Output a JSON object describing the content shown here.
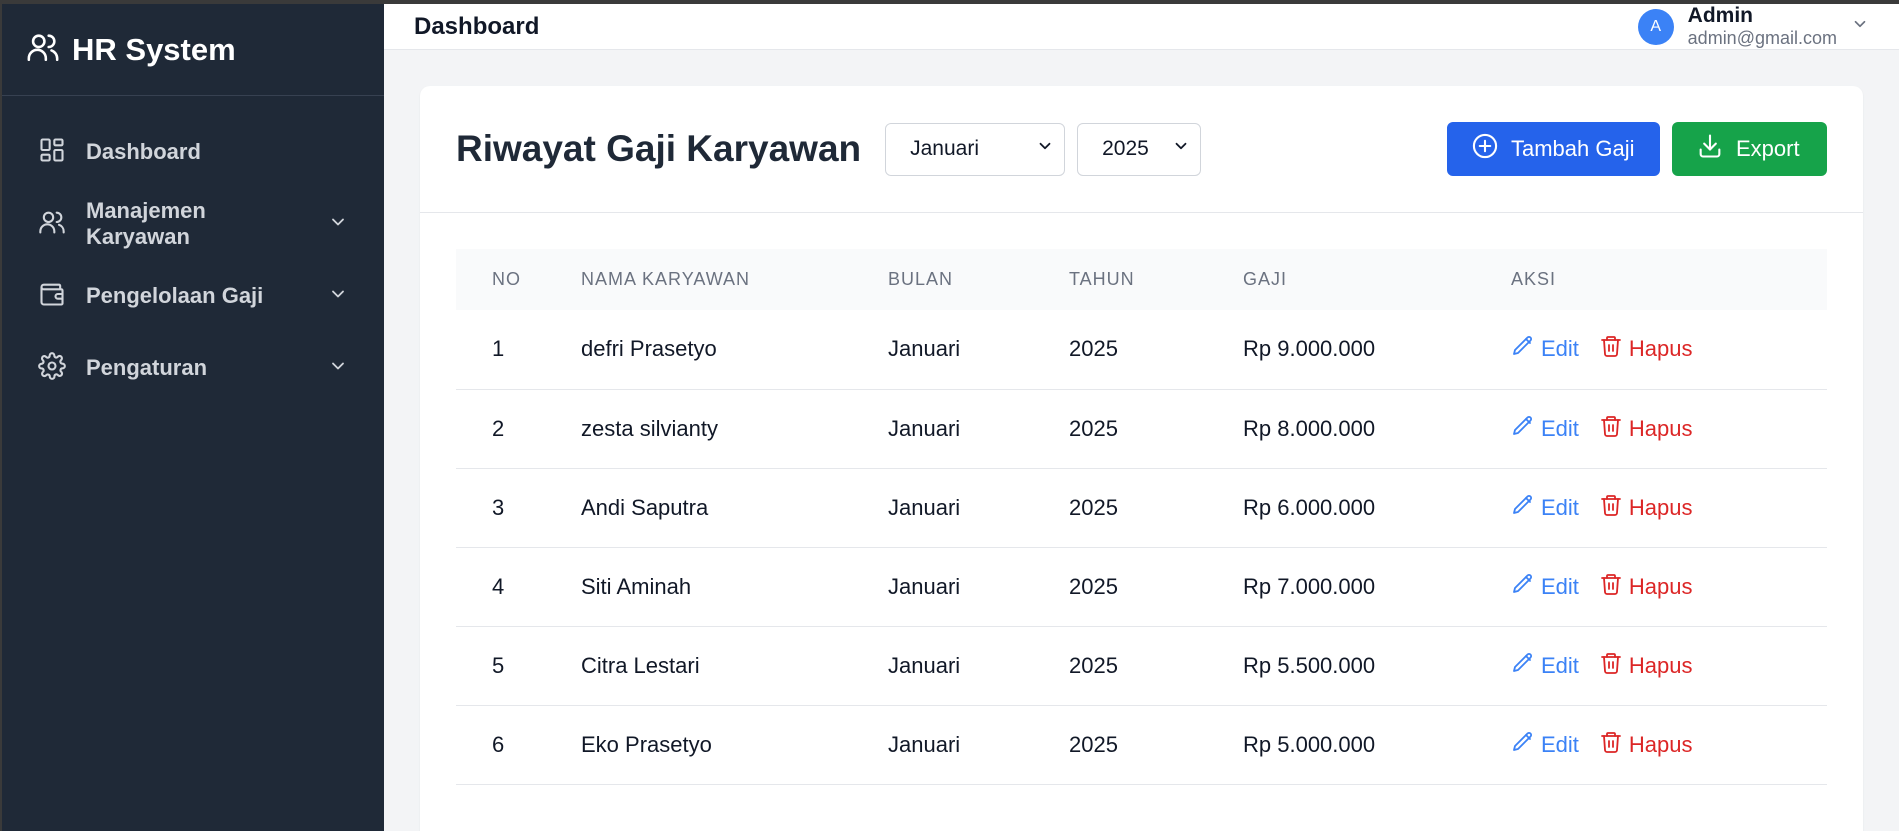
{
  "sidebar": {
    "brand": "HR System",
    "items": [
      {
        "label": "Dashboard",
        "icon": "dashboard-icon"
      },
      {
        "label": "Manajemen Karyawan",
        "icon": "users-icon"
      },
      {
        "label": "Pengelolaan Gaji",
        "icon": "wallet-icon"
      },
      {
        "label": "Pengaturan",
        "icon": "gear-icon"
      }
    ]
  },
  "topbar": {
    "title": "Dashboard",
    "user": {
      "initial": "A",
      "name": "Admin",
      "email": "admin@gmail.com"
    }
  },
  "page": {
    "title": "Riwayat Gaji Karyawan",
    "filters": {
      "month": "Januari",
      "year": "2025"
    },
    "buttons": {
      "add": "Tambah Gaji",
      "export": "Export"
    }
  },
  "table": {
    "headers": [
      "NO",
      "NAMA KARYAWAN",
      "BULAN",
      "TAHUN",
      "GAJI",
      "AKSI"
    ],
    "action_labels": {
      "edit": "Edit",
      "delete": "Hapus"
    },
    "rows": [
      {
        "no": "1",
        "name": "defri Prasetyo",
        "bulan": "Januari",
        "tahun": "2025",
        "gaji": "Rp 9.000.000"
      },
      {
        "no": "2",
        "name": "zesta silvianty",
        "bulan": "Januari",
        "tahun": "2025",
        "gaji": "Rp 8.000.000"
      },
      {
        "no": "3",
        "name": "Andi Saputra",
        "bulan": "Januari",
        "tahun": "2025",
        "gaji": "Rp 6.000.000"
      },
      {
        "no": "4",
        "name": "Siti Aminah",
        "bulan": "Januari",
        "tahun": "2025",
        "gaji": "Rp 7.000.000"
      },
      {
        "no": "5",
        "name": "Citra Lestari",
        "bulan": "Januari",
        "tahun": "2025",
        "gaji": "Rp 5.500.000"
      },
      {
        "no": "6",
        "name": "Eko Prasetyo",
        "bulan": "Januari",
        "tahun": "2025",
        "gaji": "Rp 5.000.000"
      }
    ]
  },
  "colors": {
    "sidebar_bg": "#1f2937",
    "primary": "#2563eb",
    "success": "#16a34a",
    "danger": "#dc2626",
    "link": "#3b82f6"
  }
}
